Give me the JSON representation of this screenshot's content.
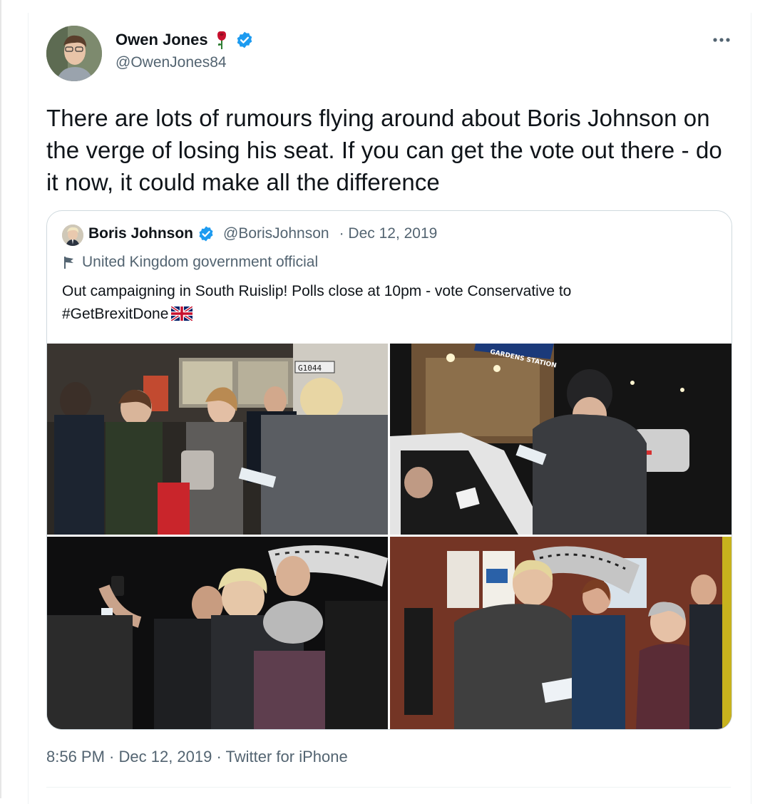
{
  "tweet": {
    "author": {
      "name": "Owen Jones",
      "emoji_icon": "red-rose-icon",
      "verified_icon": "verified-badge-icon",
      "handle": "@OwenJones84"
    },
    "more_icon": "more-options-icon",
    "text": "There are lots of rumours flying around about Boris Johnson on the verge of losing his seat. If you can get the vote out there - do it now, it could make all the difference",
    "quoted": {
      "name": "Boris Johnson",
      "handle": "@BorisJohnson",
      "date": "· Dec 12, 2019",
      "label": "United Kingdom government official",
      "text_line1": "Out campaigning in South Ruislip! Polls close at 10pm - vote Conservative to",
      "hashtag": "#GetBrexitDone",
      "photos": [
        {
          "desc": "campaign-photo-station-entrance",
          "sign_text": "G1044"
        },
        {
          "desc": "campaign-photo-car-window",
          "sign_text": "GARDENS STATION"
        },
        {
          "desc": "campaign-photo-selfie"
        },
        {
          "desc": "campaign-photo-underground-platform"
        }
      ]
    },
    "footer": {
      "time": "8:56 PM",
      "sep": " · ",
      "date": "Dec 12, 2019",
      "source": "Twitter for iPhone"
    }
  },
  "colors": {
    "text_primary": "#0f1419",
    "text_secondary": "#536471",
    "verified_blue": "#1d9bf0",
    "border": "#cfd9de",
    "rose_red": "#c8102e"
  }
}
